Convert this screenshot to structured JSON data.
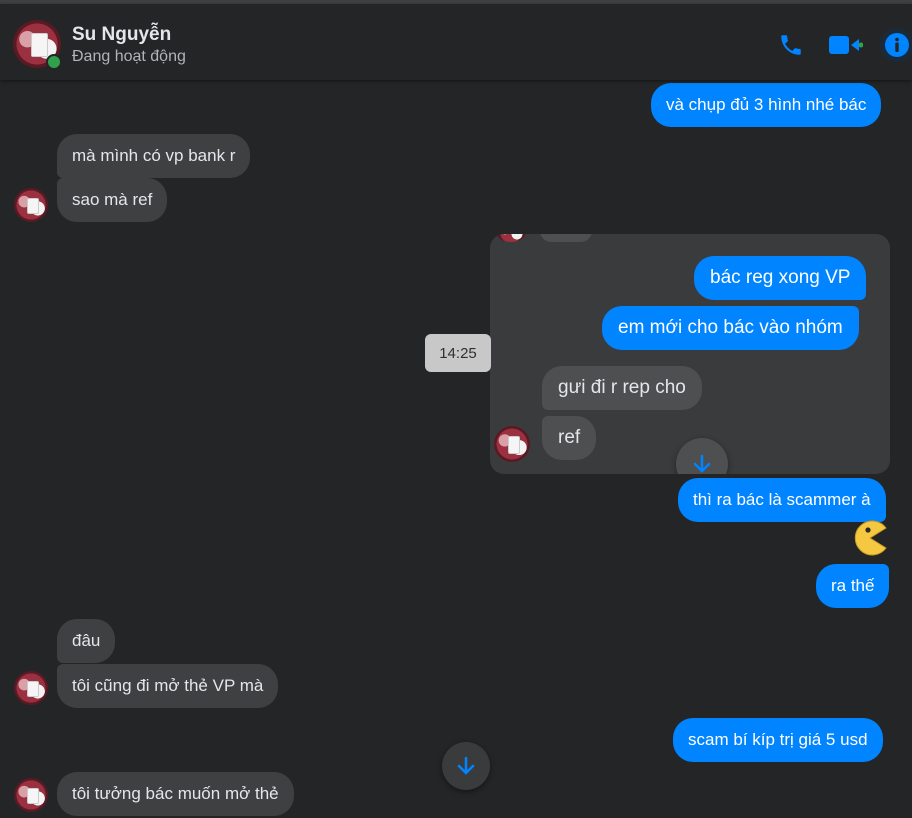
{
  "header": {
    "name": "Su Nguyễn",
    "status": "Đang hoạt động",
    "icons": [
      "phone-icon",
      "video-icon",
      "info-icon"
    ]
  },
  "messages": {
    "m1": "và chụp đủ 3 hình nhé bác",
    "m2": "mà mình có vp bank r",
    "m3": "sao mà ref",
    "m4": "thì ra bác là scammer à",
    "m5": "ra thế",
    "m6": "đâu",
    "m7": "tôi cũng đi mở thẻ VP mà",
    "m8": "scam bí kíp trị giá 5 usd",
    "m9": "tôi tưởng bác muốn mở thẻ"
  },
  "reply_card": {
    "r1": "bác reg xong VP",
    "r2": "em mới cho bác vào nhóm",
    "r3": "gưi đi r rep cho",
    "r4": "ref"
  },
  "time_label": "14:25",
  "colors": {
    "background": "#242526",
    "incoming_bubble": "#3e4042",
    "outgoing_bubble": "#0084ff",
    "accent": "#0084ff",
    "online": "#31a24c"
  }
}
